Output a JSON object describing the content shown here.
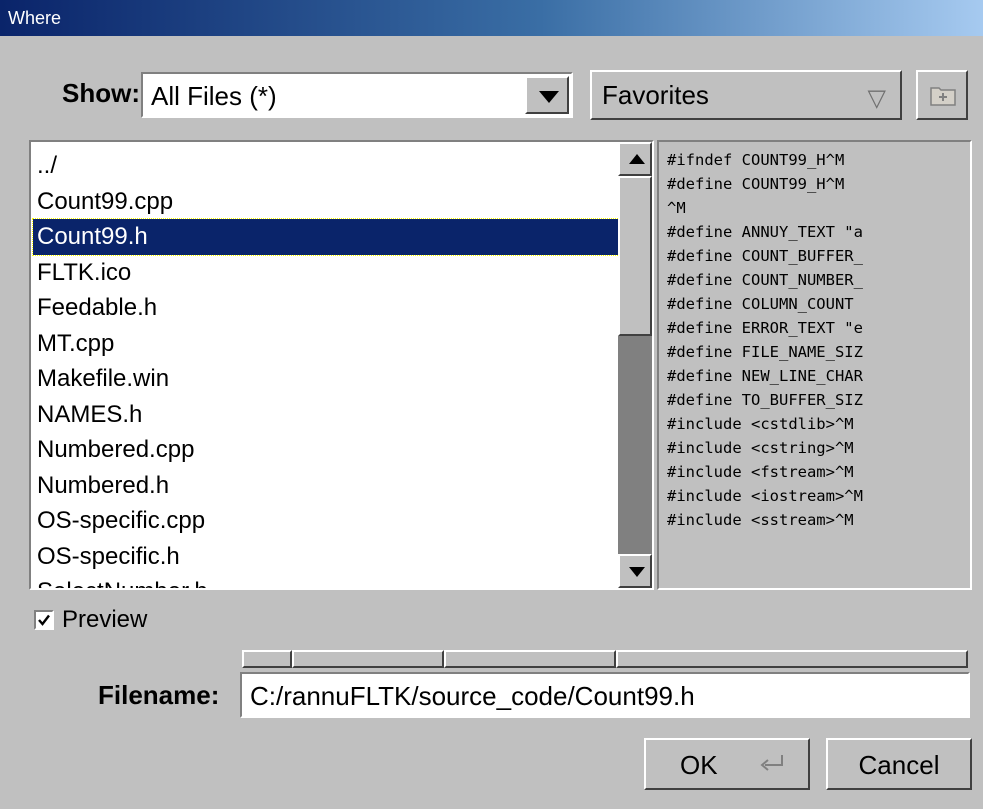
{
  "window": {
    "title": "Where"
  },
  "show": {
    "label": "Show:",
    "selected": "All Files (*)"
  },
  "favorites": {
    "label": "Favorites"
  },
  "file_list": {
    "items": [
      "../",
      "Count99.cpp",
      "Count99.h",
      "FLTK.ico",
      "Feedable.h",
      "MT.cpp",
      "Makefile.win",
      "NAMES.h",
      "Numbered.cpp",
      "Numbered.h",
      "OS-specific.cpp",
      "OS-specific.h",
      "SelectNumber.h"
    ],
    "selected_index": 2
  },
  "preview_text": {
    "lines": [
      "#ifndef COUNT99_H^M",
      "#define COUNT99_H^M",
      "^M",
      "#define ANNUY_TEXT \"a",
      "#define COUNT_BUFFER_",
      "#define COUNT_NUMBER_",
      "#define COLUMN_COUNT ",
      "#define ERROR_TEXT \"e",
      "#define FILE_NAME_SIZ",
      "#define NEW_LINE_CHAR",
      "#define TO_BUFFER_SIZ",
      "#include <cstdlib>^M",
      "#include <cstring>^M",
      "#include <fstream>^M",
      "#include <iostream>^M",
      "#include <sstream>^M"
    ]
  },
  "preview_checkbox": {
    "label": "Preview",
    "checked": true
  },
  "filename": {
    "label": "Filename:",
    "value": "C:/rannuFLTK/source_code/Count99.h"
  },
  "buttons": {
    "ok_label": "OK",
    "cancel_label": "Cancel"
  },
  "colors": {
    "selection": "#0a246a",
    "face": "#c0c0c0",
    "title_gradient_start": "#0a246a"
  }
}
